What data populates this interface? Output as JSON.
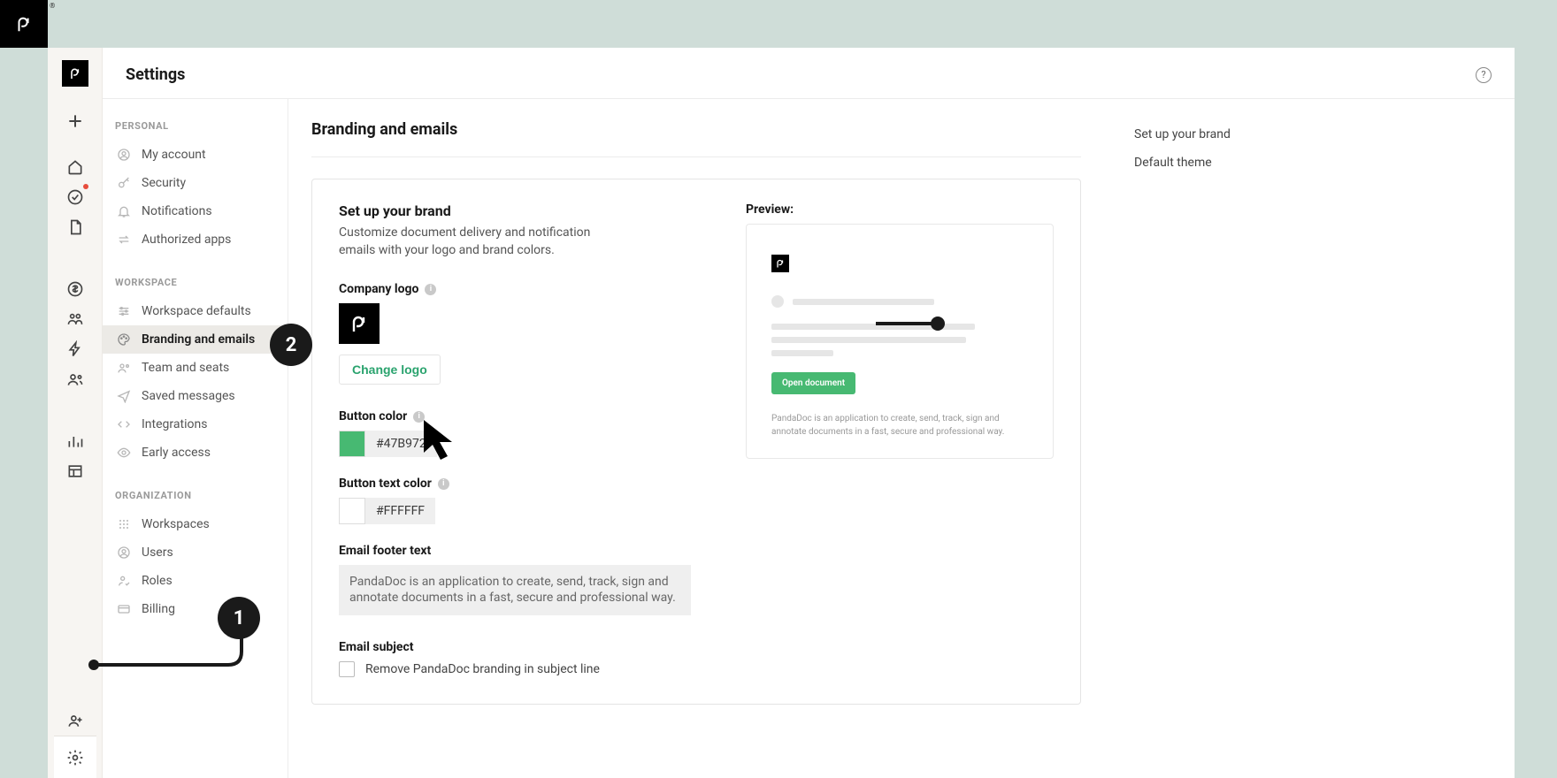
{
  "header": {
    "title": "Settings"
  },
  "settings_nav": {
    "sections": [
      {
        "title": "PERSONAL",
        "items": [
          {
            "label": "My account",
            "icon": "user-circle"
          },
          {
            "label": "Security",
            "icon": "key"
          },
          {
            "label": "Notifications",
            "icon": "bell"
          },
          {
            "label": "Authorized apps",
            "icon": "swap"
          }
        ]
      },
      {
        "title": "WORKSPACE",
        "items": [
          {
            "label": "Workspace defaults",
            "icon": "sliders"
          },
          {
            "label": "Branding and emails",
            "icon": "palette",
            "active": true
          },
          {
            "label": "Team and seats",
            "icon": "team"
          },
          {
            "label": "Saved messages",
            "icon": "send"
          },
          {
            "label": "Integrations",
            "icon": "code"
          },
          {
            "label": "Early access",
            "icon": "eye"
          }
        ]
      },
      {
        "title": "ORGANIZATION",
        "items": [
          {
            "label": "Workspaces",
            "icon": "grid"
          },
          {
            "label": "Users",
            "icon": "user-circle"
          },
          {
            "label": "Roles",
            "icon": "user-check"
          },
          {
            "label": "Billing",
            "icon": "card"
          }
        ]
      }
    ]
  },
  "content": {
    "title": "Branding and emails",
    "brand": {
      "heading": "Set up your brand",
      "description": "Customize document delivery and notification emails with your logo and brand colors.",
      "company_logo_label": "Company logo",
      "change_logo_label": "Change logo",
      "button_color_label": "Button color",
      "button_color_value": "#47B972",
      "button_text_color_label": "Button text color",
      "button_text_color_value": "#FFFFFF",
      "email_footer_label": "Email footer text",
      "email_footer_value": "PandaDoc is an application to create, send, track, sign and annotate documents in a fast, secure and professional way.",
      "email_subject_label": "Email subject",
      "remove_branding_label": "Remove PandaDoc branding in subject line"
    },
    "preview": {
      "label": "Preview:",
      "button_label": "Open document",
      "footer_text": "PandaDoc is an application to create, send, track, sign and annotate documents in a fast, secure and professional way."
    },
    "aside": {
      "link_setup": "Set up your brand",
      "link_theme": "Default theme"
    }
  },
  "tour": {
    "badge1": "1",
    "badge2": "2"
  },
  "colors": {
    "brand_green": "#47B972"
  }
}
